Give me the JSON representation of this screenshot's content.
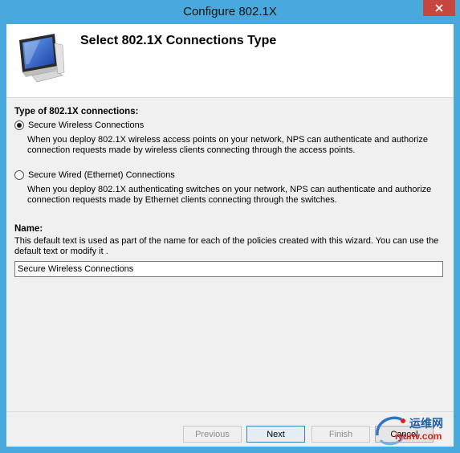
{
  "window": {
    "title": "Configure 802.1X"
  },
  "header": {
    "title": "Select 802.1X Connections Type",
    "icon": "monitor-icon"
  },
  "connection_type": {
    "label": "Type of 802.1X connections:",
    "options": [
      {
        "label": "Secure Wireless Connections",
        "selected": true,
        "description": "When you deploy 802.1X wireless access points on your network, NPS can authenticate and authorize connection requests made by wireless clients connecting through the access points."
      },
      {
        "label": "Secure Wired (Ethernet) Connections",
        "selected": false,
        "description": "When you deploy 802.1X authenticating switches on your network, NPS can authenticate and authorize connection requests made by Ethernet clients connecting through the switches."
      }
    ]
  },
  "name": {
    "label": "Name:",
    "help": "This default text is used as part of the name for each of the policies created with this wizard. You can use the default text or modify it .",
    "value": "Secure Wireless Connections"
  },
  "buttons": {
    "previous": "Previous",
    "next": "Next",
    "finish": "Finish",
    "cancel": "Cancel"
  },
  "watermark": {
    "line1": "运维网",
    "line2": "iyunv.com"
  },
  "colors": {
    "titlebar": "#4aa9dc",
    "close": "#c7463e"
  }
}
